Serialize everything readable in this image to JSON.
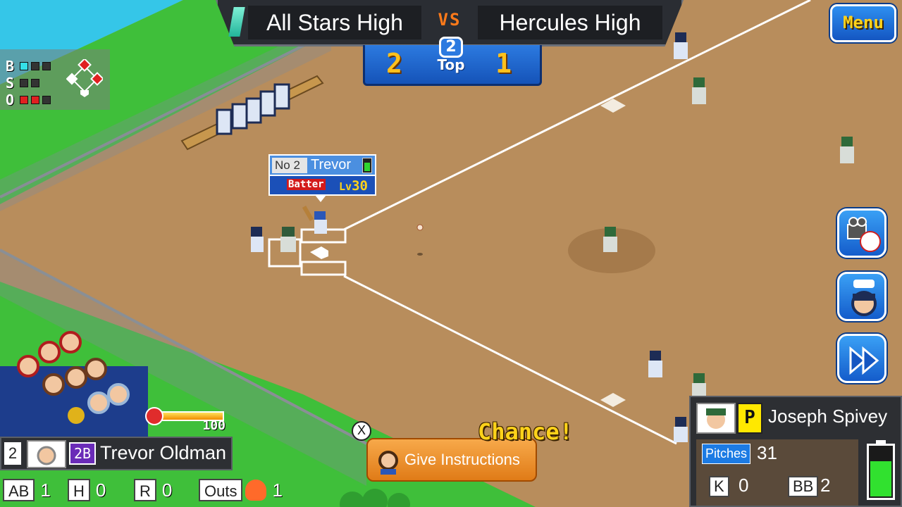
{
  "scoreboard": {
    "away_team": "All Stars High",
    "home_team": "Hercules High",
    "vs": "VS",
    "away_score": "2",
    "home_score": "1",
    "inning": "2",
    "half": "Top"
  },
  "menu": {
    "label": "Menu"
  },
  "count": {
    "ball_letter": "B",
    "strike_letter": "S",
    "out_letter": "O",
    "balls": 1,
    "strikes": 0,
    "outs": 2
  },
  "player_tag": {
    "no_label": "No",
    "number": "2",
    "name": "Trevor",
    "role": "Batter",
    "lv_label": "Lv",
    "level": "30"
  },
  "actions": [
    {
      "name": "camera-pitch-icon"
    },
    {
      "name": "speak-coach-icon"
    },
    {
      "name": "fast-forward-icon"
    }
  ],
  "batter": {
    "order": "2",
    "position": "2B",
    "name": "Trevor Oldman",
    "power": "100",
    "power_fraction": 1.0,
    "stats": {
      "ab_label": "AB",
      "ab": "1",
      "h_label": "H",
      "h": "0",
      "r_label": "R",
      "r": "0",
      "outs_label": "Outs",
      "outs": "1"
    }
  },
  "instructions": {
    "close": "X",
    "label": "Give Instructions",
    "chance": "Chance!"
  },
  "pitcher": {
    "position": "P",
    "name": "Joseph Spivey",
    "pitches_label": "Pitches",
    "pitches": "31",
    "k_label": "K",
    "k": "0",
    "bb_label": "BB",
    "bb": "2",
    "stamina_fraction": 0.72
  },
  "colors": {
    "dirt": "#b88d5c",
    "grass": "#3fbf3a",
    "water": "#35c6e8",
    "accent_blue": "#1c7be4",
    "highlight_yellow": "#ffd21a"
  }
}
